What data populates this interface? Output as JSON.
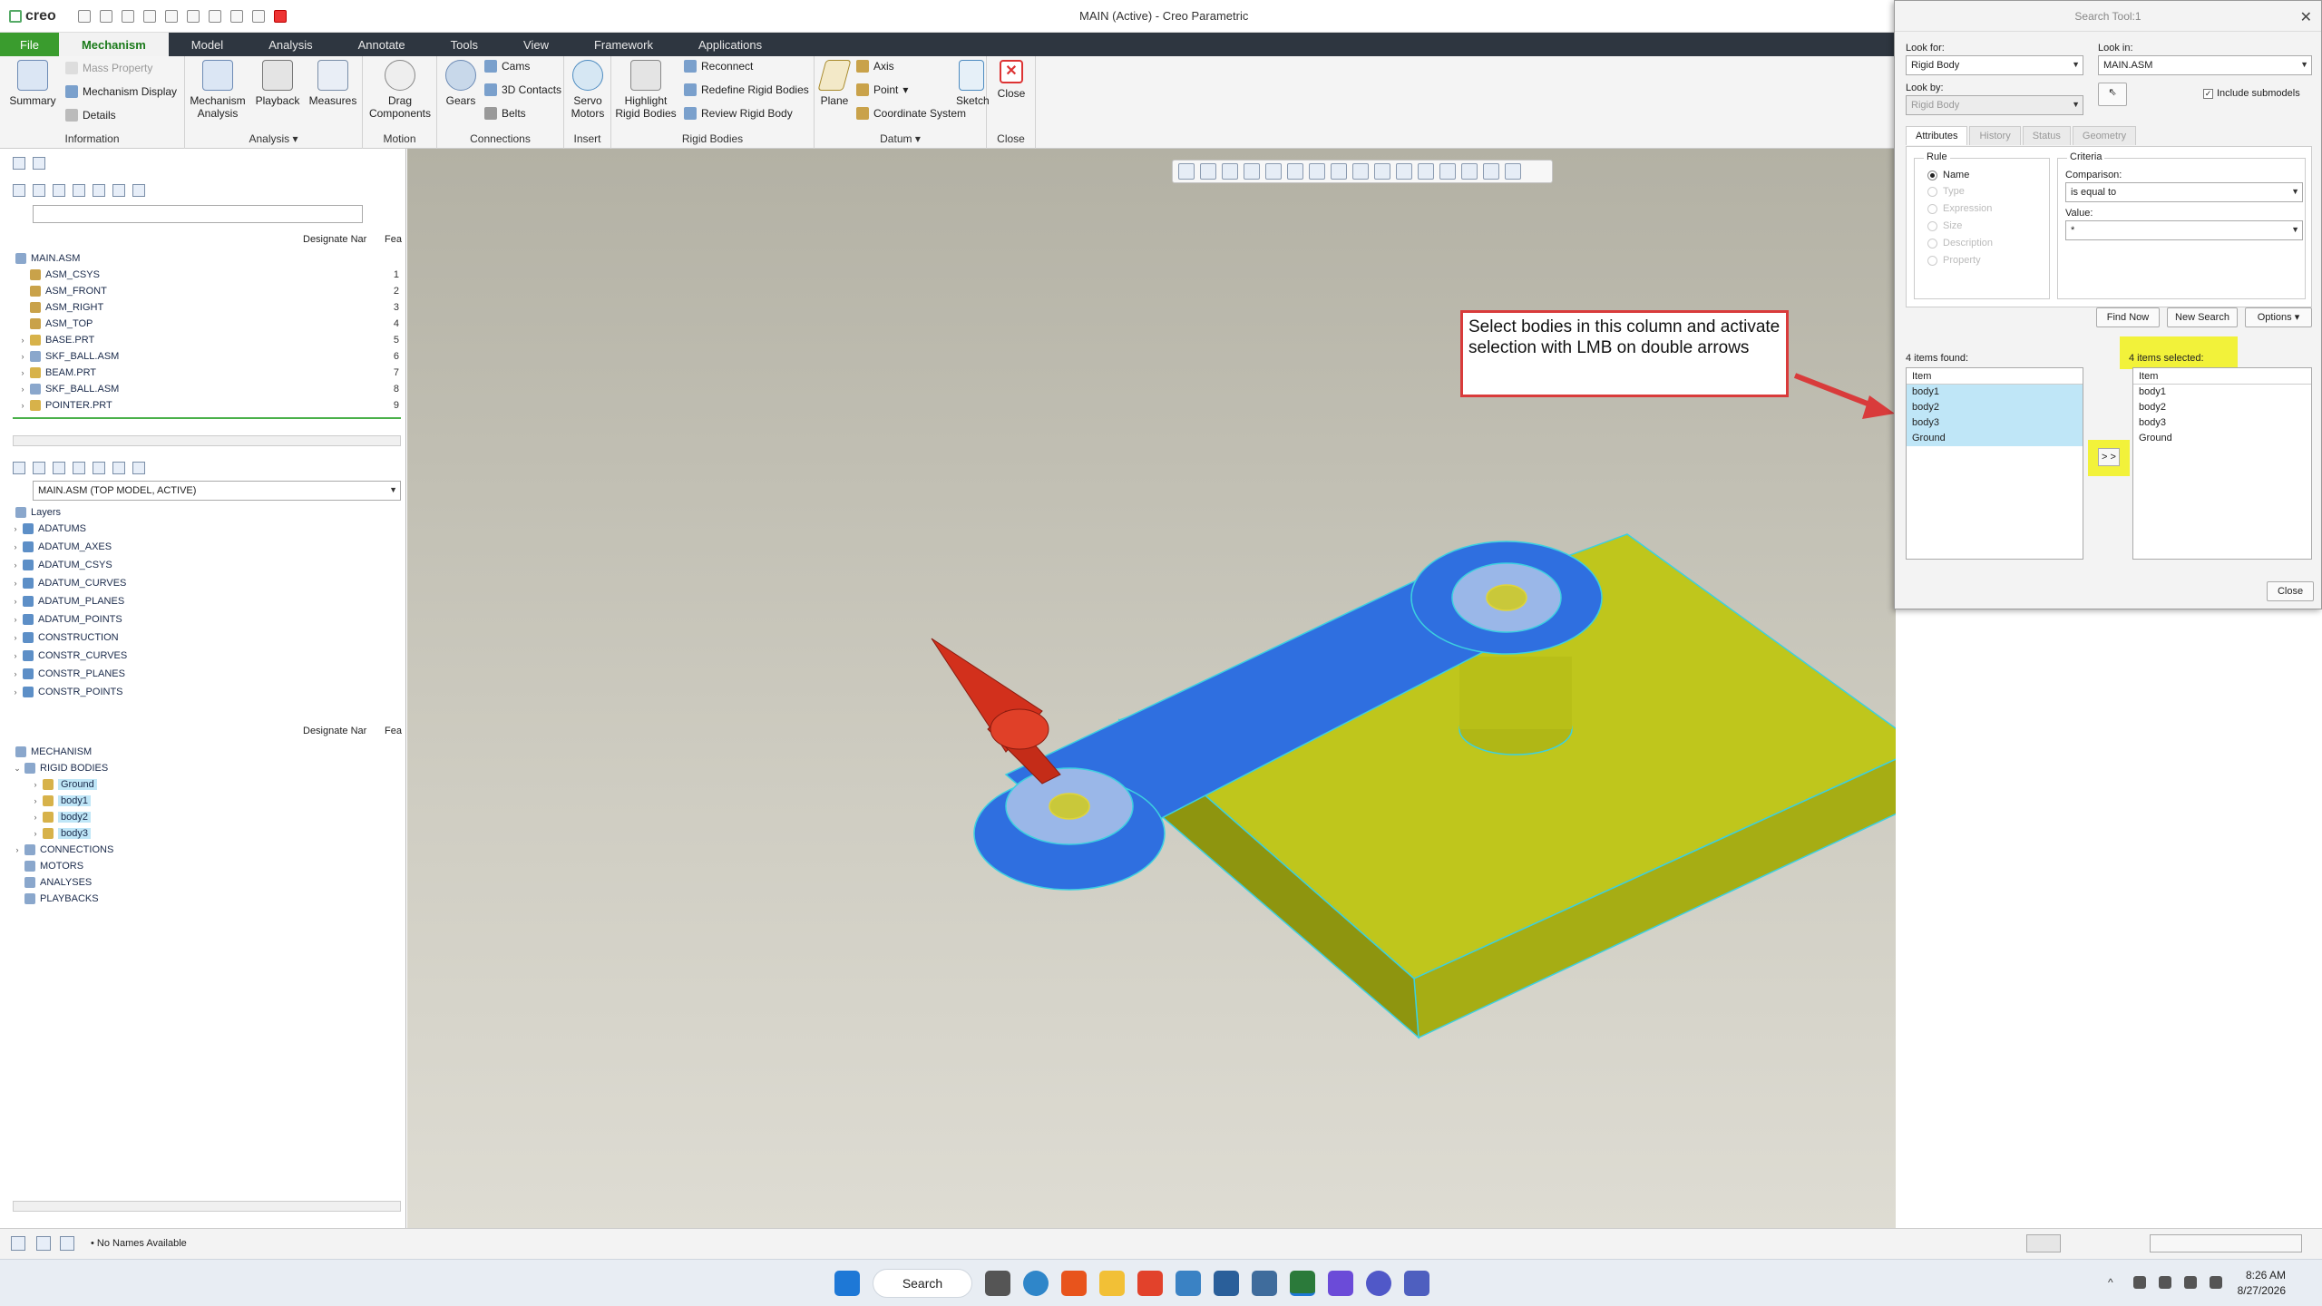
{
  "window_title": "MAIN (Active) - Creo Parametric",
  "app_name": "creo",
  "menu_tabs": [
    "File",
    "Mechanism",
    "Model",
    "Analysis",
    "Annotate",
    "Tools",
    "View",
    "Framework",
    "Applications"
  ],
  "ribbon": {
    "information": {
      "title": "Information",
      "summary": "Summary",
      "mass_property": "Mass Property",
      "mechanism_display": "Mechanism Display",
      "details": "Details"
    },
    "analysis": {
      "title": "Analysis",
      "mechanism_analysis_1": "Mechanism",
      "mechanism_analysis_2": "Analysis",
      "playback": "Playback",
      "measures": "Measures"
    },
    "motion": {
      "title": "Motion",
      "drag_1": "Drag",
      "drag_2": "Components"
    },
    "connections": {
      "title": "Connections",
      "gears": "Gears",
      "cams": "Cams",
      "contacts": "3D Contacts",
      "belts": "Belts"
    },
    "insert": {
      "title": "Insert",
      "servo_1": "Servo",
      "servo_2": "Motors"
    },
    "rigid_bodies": {
      "title": "Rigid Bodies",
      "highlight_1": "Highlight",
      "highlight_2": "Rigid Bodies",
      "reconnect": "Reconnect",
      "redefine": "Redefine Rigid Bodies",
      "review": "Review Rigid Body"
    },
    "datum": {
      "title": "Datum",
      "plane": "Plane",
      "axis": "Axis",
      "point": "Point",
      "csys": "Coordinate System",
      "sketch": "Sketch"
    },
    "close": {
      "title": "Close",
      "close": "Close"
    }
  },
  "model_tree": {
    "col_designate": "Designate Nar",
    "col_feat": "Fea",
    "rows": [
      {
        "label": "MAIN.ASM",
        "num": ""
      },
      {
        "label": "ASM_CSYS",
        "num": "1"
      },
      {
        "label": "ASM_FRONT",
        "num": "2"
      },
      {
        "label": "ASM_RIGHT",
        "num": "3"
      },
      {
        "label": "ASM_TOP",
        "num": "4"
      },
      {
        "label": "BASE.PRT",
        "num": "5"
      },
      {
        "label": "SKF_BALL.ASM",
        "num": "6"
      },
      {
        "label": "BEAM.PRT",
        "num": "7"
      },
      {
        "label": "SKF_BALL.ASM",
        "num": "8"
      },
      {
        "label": "POINTER.PRT",
        "num": "9"
      }
    ]
  },
  "layer_tree": {
    "model_select": "MAIN.ASM (TOP MODEL, ACTIVE)",
    "root": "Layers",
    "items": [
      "ADATUMS",
      "ADATUM_AXES",
      "ADATUM_CSYS",
      "ADATUM_CURVES",
      "ADATUM_PLANES",
      "ADATUM_POINTS",
      "CONSTRUCTION",
      "CONSTR_CURVES",
      "CONSTR_PLANES",
      "CONSTR_POINTS"
    ]
  },
  "mechanism_tree": {
    "col_designate": "Designate Nar",
    "col_feat": "Fea",
    "root": "MECHANISM",
    "rigid_bodies": "RIGID BODIES",
    "bodies": [
      "Ground",
      "body1",
      "body2",
      "body3"
    ],
    "others": [
      "CONNECTIONS",
      "MOTORS",
      "ANALYSES",
      "PLAYBACKS"
    ]
  },
  "callout_text": "Select bodies in this column and activate selection with LMB on double arrows",
  "search_dialog": {
    "title": "Search Tool:1",
    "look_for_label": "Look for:",
    "look_for_value": "Rigid Body",
    "look_in_label": "Look in:",
    "look_in_value": "MAIN.ASM",
    "look_by_label": "Look by:",
    "look_by_value": "Rigid Body",
    "include_submodels": "Include submodels",
    "tabs": [
      "Attributes",
      "History",
      "Status",
      "Geometry"
    ],
    "rule_title": "Rule",
    "rules": [
      "Name",
      "Type",
      "Expression",
      "Size",
      "Description",
      "Property"
    ],
    "criteria_title": "Criteria",
    "comparison_label": "Comparison:",
    "comparison_value": "is equal to",
    "value_label": "Value:",
    "value_value": "*",
    "find_now": "Find Now",
    "new_search": "New Search",
    "options": "Options",
    "found_label": "4 items found:",
    "selected_label": "4 items selected:",
    "item_header": "Item",
    "found_items": [
      "body1",
      "body2",
      "body3",
      "Ground"
    ],
    "selected_items": [
      "body1",
      "body2",
      "body3",
      "Ground"
    ],
    "move_label": "> >",
    "close": "Close"
  },
  "status_bar": {
    "message": "No Names Available"
  },
  "taskbar": {
    "search": "Search",
    "time": "8:26 AM",
    "date": "8/27/2026"
  },
  "colors": {
    "accent_green": "#3a9c2e",
    "highlight_blue": "#bfe6f7",
    "callout_red": "#d93b3b",
    "note_yellow": "#f2f23a",
    "body_blue": "#2f6fe0",
    "base_yellow": "#b7c01a"
  }
}
